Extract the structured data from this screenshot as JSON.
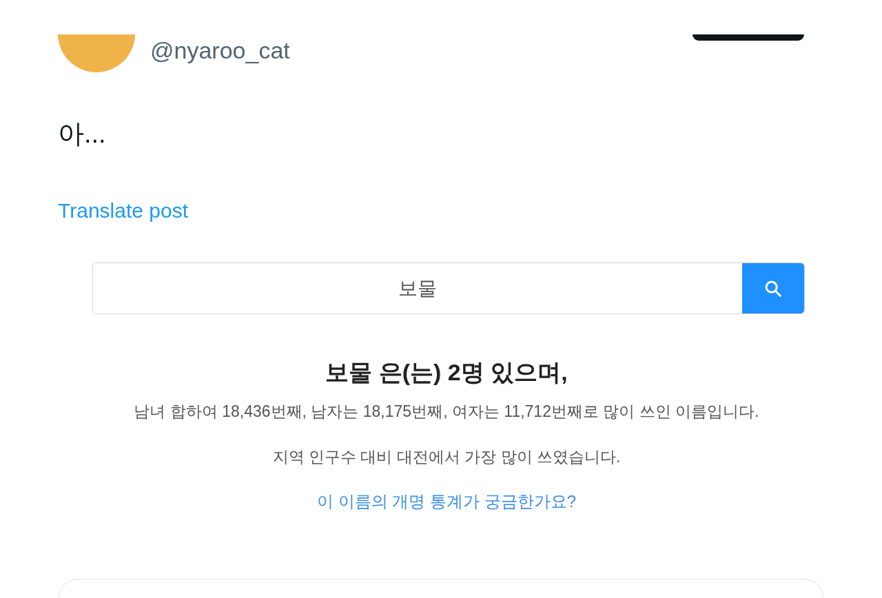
{
  "post": {
    "handle": "@nyaroo_cat",
    "text": "아...",
    "translate_link": "Translate post"
  },
  "embedded_page": {
    "search": {
      "value": "보물"
    },
    "heading": "보물 은(는) 2명 있으며,",
    "lines": [
      "남녀 합하여 18,436번째, 남자는 18,175번째, 여자는 11,712번째로 많이 쓰인 이름입니다.",
      "지역 인구수 대비 대전에서 가장 많이 쓰였습니다."
    ],
    "link": "이 이름의 개명 통계가 궁금한가요?"
  }
}
